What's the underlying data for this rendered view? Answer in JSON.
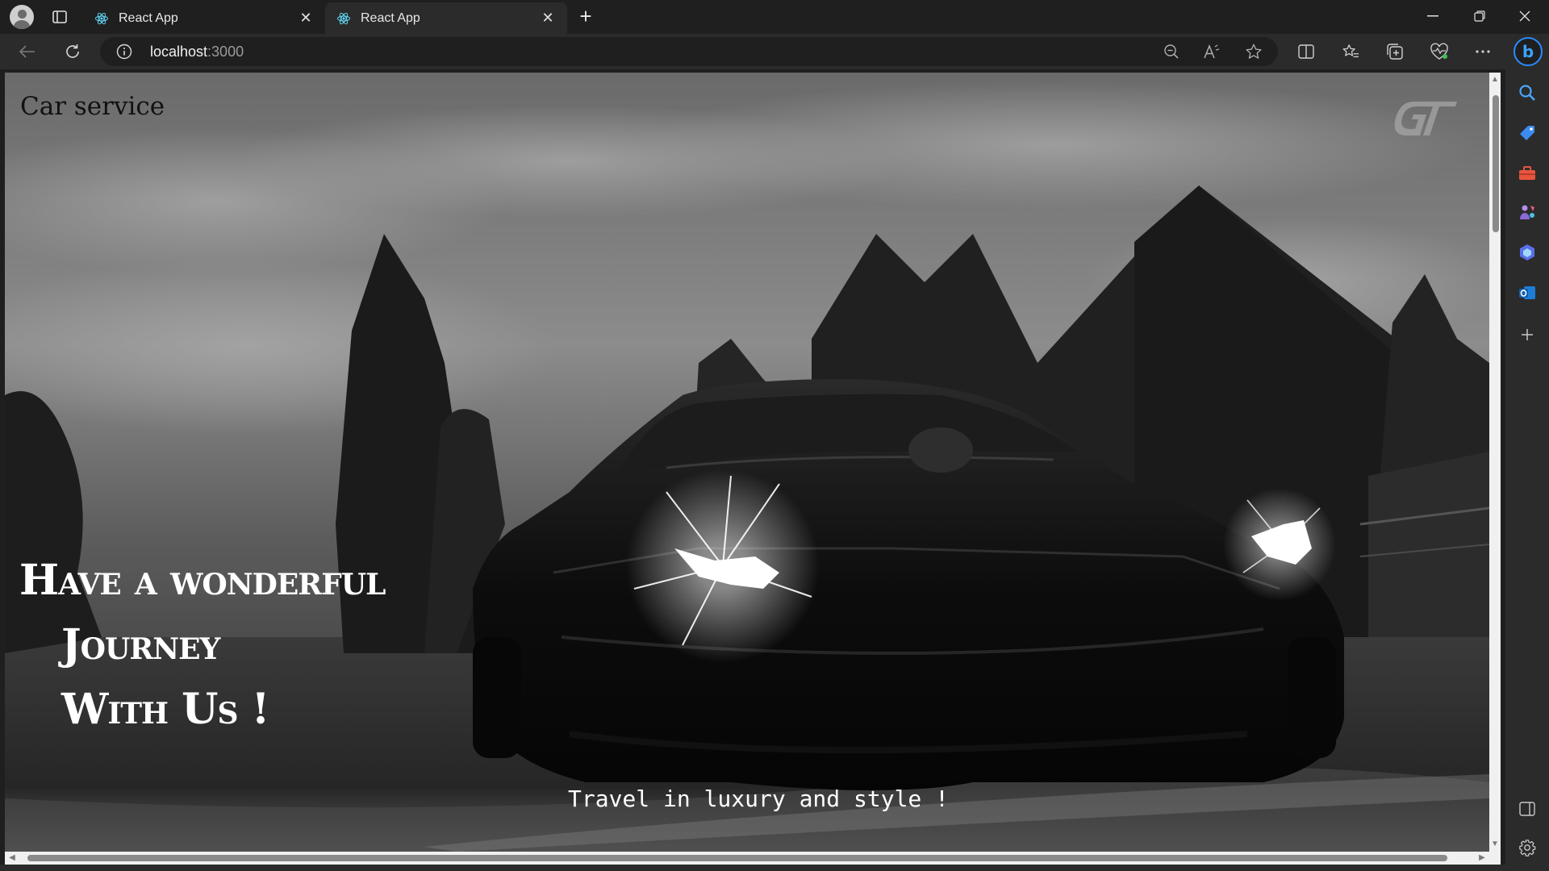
{
  "browser": {
    "tabs": [
      {
        "label": "React App",
        "active": false
      },
      {
        "label": "React App",
        "active": true
      }
    ],
    "address": {
      "host": "localhost",
      "port": ":3000"
    },
    "accent": "#2a8cff"
  },
  "page": {
    "brand": "Car service",
    "headline": {
      "line1": "Have a wonderful",
      "line2": "Journey",
      "line3": "With Us !"
    },
    "tagline": "Travel in luxury and style !",
    "logo_icon": "gt-logo-icon"
  }
}
